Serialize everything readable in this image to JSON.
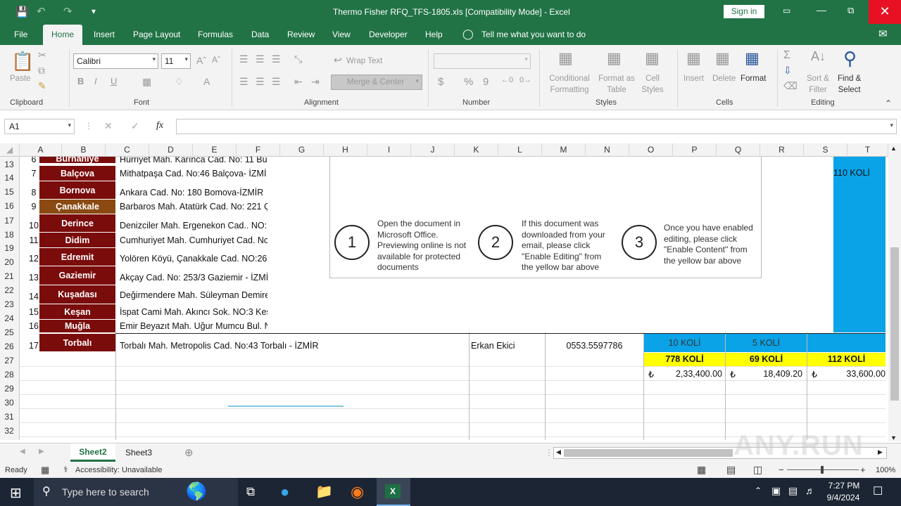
{
  "window": {
    "title": "Thermo Fisher RFQ_TFS-1805.xls  [Compatibility Mode]  -  Excel",
    "sign_in": "Sign in"
  },
  "tabs": [
    "File",
    "Home",
    "Insert",
    "Page Layout",
    "Formulas",
    "Data",
    "Review",
    "View",
    "Developer",
    "Help"
  ],
  "tell_me": "Tell me what you want to do",
  "ribbon": {
    "clipboard": {
      "paste": "Paste",
      "label": "Clipboard"
    },
    "font": {
      "name": "Calibri",
      "size": "11",
      "label": "Font",
      "bold": "B",
      "italic": "I",
      "underline": "U"
    },
    "alignment": {
      "wrap": "Wrap Text",
      "merge": "Merge & Center",
      "label": "Alignment"
    },
    "number": {
      "label": "Number",
      "currency": "$",
      "percent": "%",
      "comma": "9"
    },
    "styles": {
      "cond1": "Conditional",
      "cond2": "Formatting",
      "fmt1": "Format as",
      "fmt2": "Table",
      "cell1": "Cell",
      "cell2": "Styles",
      "label": "Styles"
    },
    "cells": {
      "insert": "Insert",
      "delete": "Delete",
      "format": "Format",
      "label": "Cells"
    },
    "editing": {
      "sort1": "Sort &",
      "sort2": "Filter",
      "find1": "Find &",
      "find2": "Select",
      "label": "Editing"
    }
  },
  "namebox": "A1",
  "fx": "fx",
  "columns": [
    "A",
    "B",
    "C",
    "D",
    "E",
    "F",
    "G",
    "H",
    "I",
    "J",
    "K",
    "L",
    "M",
    "N",
    "O",
    "P",
    "Q",
    "R",
    "S",
    "T"
  ],
  "rownums": [
    "13",
    "14",
    "15",
    "16",
    "17",
    "18",
    "19",
    "20",
    "21",
    "22",
    "23",
    "24",
    "25",
    "26",
    "27",
    "28",
    "29",
    "30",
    "31",
    "32"
  ],
  "rows": [
    {
      "no": "6",
      "city": "Burnaniye",
      "addr": "Hürriyet Mah. Karınca Cad. No: 11 Bu"
    },
    {
      "no": "7",
      "city": "Balçova",
      "addr": "Mithatpaşa Cad. No:46  Balçova- İZMİ"
    },
    {
      "no": "8",
      "city": "Bornova",
      "addr": "Ankara Cad. No: 180 Bomova-İZMİR"
    },
    {
      "no": "9",
      "city": "Çanakkale",
      "addr": "Barbaros Mah. Atatürk Cad. No: 221 Ç"
    },
    {
      "no": "10",
      "city": "Derince",
      "addr": "Denizciler Mah. Ergenekon Cad.. NO:2"
    },
    {
      "no": "11",
      "city": "Didim",
      "addr": "Cumhuriyet Mah. Cumhuriyet Cad. No"
    },
    {
      "no": "12",
      "city": "Edremit",
      "addr": "Yolören Köyü, Çanakkale Cad. NO:26"
    },
    {
      "no": "13",
      "city": "Gaziemir",
      "addr": "Akçay Cad. No: 253/3 Gaziemir - İZMİ"
    },
    {
      "no": "14",
      "city": "Kuşadası",
      "addr": "Değirmendere Mah. Süleyman Demire"
    },
    {
      "no": "15",
      "city": "Keşan",
      "addr": "İspat Cami Mah. Akıncı Sok. NO:3 Keş"
    },
    {
      "no": "16",
      "city": "Muğla",
      "addr": "Emir Beyazıt Mah. Uğur Mumcu Bul. N"
    },
    {
      "no": "17",
      "city": "Torbalı",
      "addr": "Torbalı Mah. Metropolis Cad. No:43 Torbalı - İZMİR"
    }
  ],
  "row26": {
    "contact": "Erkan Ekici",
    "phone": "0553.5597786",
    "koli1": "10 KOLİ",
    "koli2": "5 KOLİ"
  },
  "row14_right": "110 KOLİ",
  "row27": [
    "778 KOLİ",
    "69 KOLİ",
    "112 KOLİ"
  ],
  "row28": [
    {
      "sym": "₺",
      "val": "2,33,400.00"
    },
    {
      "sym": "₺",
      "val": "18,409.20"
    },
    {
      "sym": "₺",
      "val": "33,600.00"
    }
  ],
  "overlay": {
    "steps": [
      {
        "num": "1",
        "text": "Open the document in Microsoft Office. Previewing online is not available for protected documents"
      },
      {
        "num": "2",
        "text": "If this document was downloaded from your email, please click \"Enable Editing\" from the yellow bar above"
      },
      {
        "num": "3",
        "text": "Once you have enabled editing, please click \"Enable Content\" from the yellow bar above"
      }
    ]
  },
  "sheets": [
    "Sheet2",
    "Sheet3"
  ],
  "status": {
    "ready": "Ready",
    "accessibility": "Accessibility: Unavailable",
    "zoom": "100%"
  },
  "taskbar": {
    "search": "Type here to search",
    "time": "7:27 PM",
    "date": "9/4/2024"
  },
  "watermark": "ANY.RUN",
  "colors": {
    "excel_green": "#217346",
    "dark_red": "#7b0c0c",
    "blue": "#0aa3e8",
    "yellow": "#ffff00"
  }
}
